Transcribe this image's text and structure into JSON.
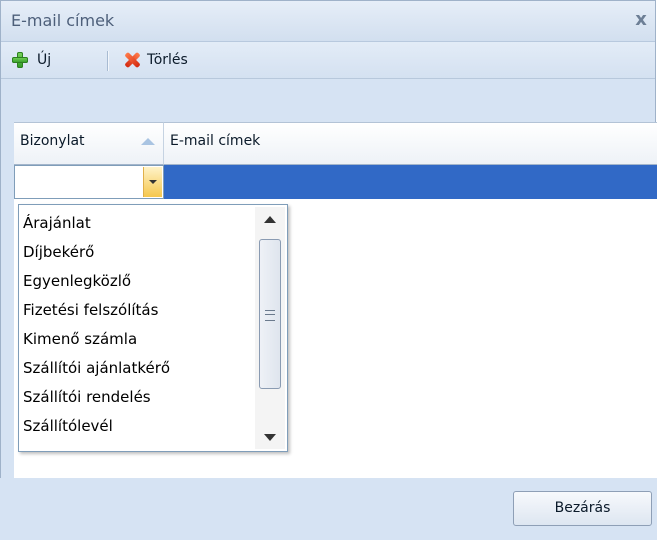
{
  "window": {
    "title": "E-mail címek",
    "close_glyph": "x"
  },
  "toolbar": {
    "new_label": "Új",
    "delete_label": "Törlés",
    "new_icon": "plus-icon",
    "delete_icon": "x-icon"
  },
  "grid": {
    "columns": [
      "Bizonylat",
      "E-mail címek"
    ],
    "sort_column": "Bizonylat",
    "sort_direction": "ascending",
    "editor_value": ""
  },
  "dropdown": {
    "items": [
      "Árajánlat",
      "Díjbekérő",
      "Egyenlegközlő",
      "Fizetési felszólítás",
      "Kimenő számla",
      "Szállítói ajánlatkérő",
      "Szállítói rendelés",
      "Szállítólevél"
    ]
  },
  "footer": {
    "close_label": "Bezárás"
  },
  "colors": {
    "selected_row": "#3169c6",
    "panel_bg": "#d6e3f3"
  }
}
